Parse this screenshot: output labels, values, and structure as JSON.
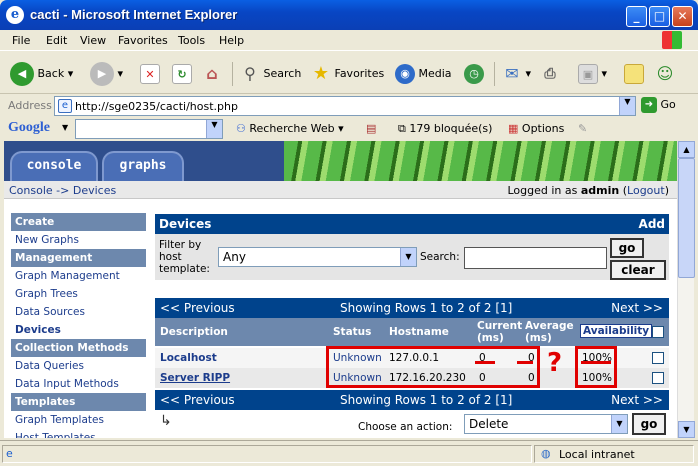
{
  "window": {
    "title": "cacti - Microsoft Internet Explorer"
  },
  "menu": [
    "File",
    "Edit",
    "View",
    "Favorites",
    "Tools",
    "Help"
  ],
  "toolbar": {
    "back": "Back",
    "search": "Search",
    "favorites": "Favorites",
    "media": "Media"
  },
  "address": {
    "label": "Address",
    "url": "http://sge0235/cacti/host.php",
    "go": "Go"
  },
  "google": {
    "logo": "Google",
    "web_search": "Recherche Web",
    "blocked": "179 bloquée(s)",
    "options": "Options"
  },
  "cacti": {
    "tabs": [
      "console",
      "graphs"
    ],
    "breadcrumb": "Console -> Devices",
    "logged_prefix": "Logged in as",
    "user": "admin",
    "logout": "Logout"
  },
  "sidebar": [
    {
      "label": "Create",
      "kind": "header"
    },
    {
      "label": "New Graphs",
      "kind": "item"
    },
    {
      "label": "Management",
      "kind": "header"
    },
    {
      "label": "Graph Management",
      "kind": "item"
    },
    {
      "label": "Graph Trees",
      "kind": "item"
    },
    {
      "label": "Data Sources",
      "kind": "item"
    },
    {
      "label": "Devices",
      "kind": "selected"
    },
    {
      "label": "Collection Methods",
      "kind": "header"
    },
    {
      "label": "Data Queries",
      "kind": "item"
    },
    {
      "label": "Data Input Methods",
      "kind": "item"
    },
    {
      "label": "Templates",
      "kind": "header"
    },
    {
      "label": "Graph Templates",
      "kind": "item"
    },
    {
      "label": "Host Templates",
      "kind": "item"
    }
  ],
  "devices": {
    "title": "Devices",
    "add": "Add",
    "filter_label": "Filter by host template:",
    "filter_value": "Any",
    "search_label": "Search:",
    "search_value": "",
    "go": "go",
    "clear": "clear",
    "prev": "<< Previous",
    "next": "Next >>",
    "showing": "Showing Rows 1 to 2 of 2 [1]",
    "columns": [
      "Description",
      "Status",
      "Hostname",
      "Current (ms)",
      "Average (ms)",
      "Availability"
    ],
    "rows": [
      {
        "description": "Localhost",
        "status": "Unknown",
        "hostname": "127.0.0.1",
        "current": "0",
        "average": "0",
        "availability": "100%"
      },
      {
        "description": "Server RIPP",
        "status": "Unknown",
        "hostname": "172.16.20.230",
        "current": "0",
        "average": "0",
        "availability": "100%"
      }
    ],
    "annotation": "?",
    "action_label": "Choose an action:",
    "action_value": "Delete",
    "action_go": "go"
  },
  "statusbar": {
    "zone": "Local intranet"
  },
  "colors": {
    "accent": "#00438c",
    "annotation": "#e00000"
  }
}
